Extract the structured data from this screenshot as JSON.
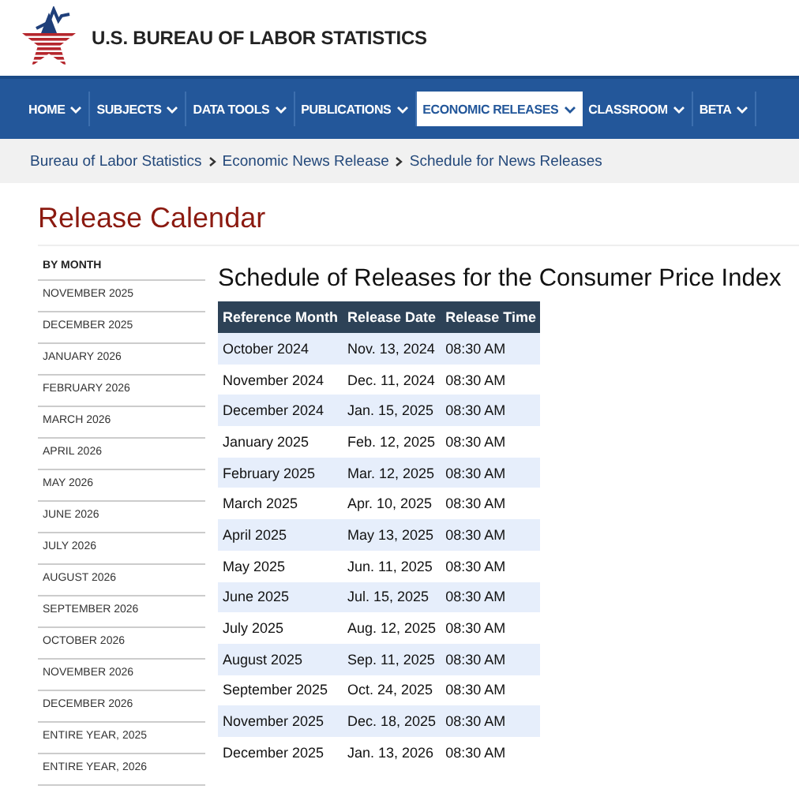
{
  "header": {
    "agency": "U.S. BUREAU OF LABOR STATISTICS"
  },
  "nav": [
    {
      "label": "HOME",
      "selected": false
    },
    {
      "label": "SUBJECTS",
      "selected": false
    },
    {
      "label": "DATA TOOLS",
      "selected": false
    },
    {
      "label": "PUBLICATIONS",
      "selected": false
    },
    {
      "label": "ECONOMIC RELEASES",
      "selected": true
    },
    {
      "label": "CLASSROOM",
      "selected": false
    },
    {
      "label": "BETA",
      "selected": false
    }
  ],
  "breadcrumbs": [
    "Bureau of Labor Statistics",
    "Economic News Release",
    "Schedule for News Releases"
  ],
  "page_title": "Release Calendar",
  "sidebar": {
    "heading": "BY MONTH",
    "items": [
      "NOVEMBER 2025",
      "DECEMBER 2025",
      "JANUARY 2026",
      "FEBRUARY 2026",
      "MARCH 2026",
      "APRIL 2026",
      "MAY 2026",
      "JUNE 2026",
      "JULY 2026",
      "AUGUST 2026",
      "SEPTEMBER 2026",
      "OCTOBER 2026",
      "NOVEMBER 2026",
      "DECEMBER 2026",
      "ENTIRE YEAR, 2025",
      "ENTIRE YEAR, 2026"
    ]
  },
  "schedule": {
    "title": "Schedule of Releases for the Consumer Price Index",
    "columns": [
      "Reference Month",
      "Release Date",
      "Release Time"
    ],
    "rows": [
      [
        "October 2024",
        "Nov. 13, 2024",
        "08:30 AM"
      ],
      [
        "November 2024",
        "Dec. 11, 2024",
        "08:30 AM"
      ],
      [
        "December 2024",
        "Jan. 15, 2025",
        "08:30 AM"
      ],
      [
        "January 2025",
        "Feb. 12, 2025",
        "08:30 AM"
      ],
      [
        "February 2025",
        "Mar. 12, 2025",
        "08:30 AM"
      ],
      [
        "March 2025",
        "Apr. 10, 2025",
        "08:30 AM"
      ],
      [
        "April 2025",
        "May 13, 2025",
        "08:30 AM"
      ],
      [
        "May 2025",
        "Jun. 11, 2025",
        "08:30 AM"
      ],
      [
        "June 2025",
        "Jul. 15, 2025",
        "08:30 AM"
      ],
      [
        "July 2025",
        "Aug. 12, 2025",
        "08:30 AM"
      ],
      [
        "August 2025",
        "Sep. 11, 2025",
        "08:30 AM"
      ],
      [
        "September 2025",
        "Oct. 24, 2025",
        "08:30 AM"
      ],
      [
        "November 2025",
        "Dec. 18, 2025",
        "08:30 AM"
      ],
      [
        "December 2025",
        "Jan. 13, 2026",
        "08:30 AM"
      ]
    ]
  }
}
